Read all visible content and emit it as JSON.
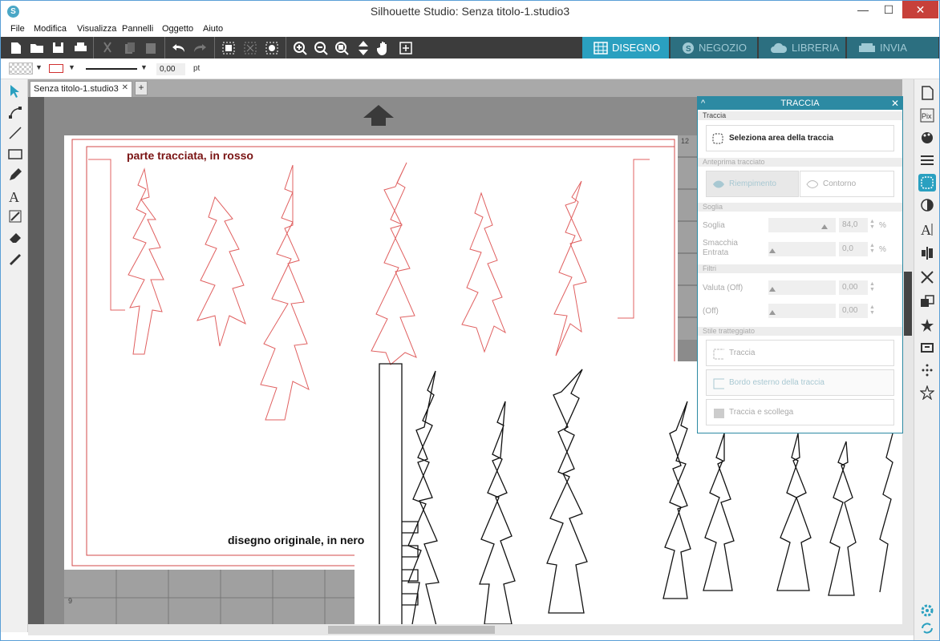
{
  "window": {
    "title": "Silhouette Studio: Senza titolo-1.studio3",
    "minimize": "—",
    "maximize": "☐",
    "close": "✕"
  },
  "menu": [
    "File",
    "Modifica",
    "Visualizza",
    "Pannelli",
    "Oggetto",
    "Aiuto"
  ],
  "tabs": [
    {
      "label": "DISEGNO",
      "active": true
    },
    {
      "label": "NEGOZIO",
      "active": false
    },
    {
      "label": "LIBRERIA",
      "active": false
    },
    {
      "label": "INVIA",
      "active": false
    }
  ],
  "props": {
    "line_width": "0,00",
    "unit": "pt"
  },
  "doc": {
    "tab": "Senza titolo-1.studio3",
    "close": "✕",
    "add": "+"
  },
  "canvas": {
    "label_red": "parte tracciata, in rosso",
    "label_black": "disegno originale, in nero",
    "ruler_top": "12",
    "ruler_left": "9"
  },
  "trace": {
    "header": "TRACCIA",
    "section_traccia": "Traccia",
    "select_area": "Seleziona area della traccia",
    "section_preview": "Anteprima tracciato",
    "fill": "Riempimento",
    "outline": "Contorno",
    "section_threshold": "Soglia",
    "threshold_label": "Soglia",
    "threshold_value": "84,0",
    "smudge_label": "Smacchia Entrata",
    "smudge_value": "0,0",
    "section_filters": "Filtri",
    "filter1_label": "Valuta (Off)",
    "filter1_value": "0,00",
    "filter2_label": "(Off)",
    "filter2_value": "0,00",
    "section_style": "Stile tratteggiato",
    "style1": "Traccia",
    "style2": "Bordo esterno della traccia",
    "style3": "Traccia e scollega",
    "percent": "%"
  },
  "colors": {
    "accent": "#2aa0c0",
    "trace": "#e06060",
    "toolbar": "#3c3c3c"
  }
}
